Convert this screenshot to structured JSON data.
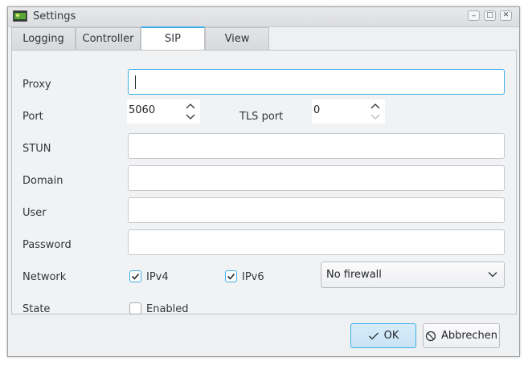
{
  "window": {
    "title": "Settings"
  },
  "titlebar_buttons": {
    "minimize": "_",
    "maximize": "□",
    "close": "✕"
  },
  "tabs": [
    {
      "label": "Logging",
      "active": false
    },
    {
      "label": "Controller",
      "active": false
    },
    {
      "label": "SIP",
      "active": true
    },
    {
      "label": "View",
      "active": false
    }
  ],
  "sip": {
    "proxy": {
      "label": "Proxy",
      "value": ""
    },
    "port": {
      "label": "Port",
      "value": "5060"
    },
    "tls_port": {
      "label": "TLS port",
      "value": "0"
    },
    "stun": {
      "label": "STUN",
      "value": ""
    },
    "domain": {
      "label": "Domain",
      "value": ""
    },
    "user": {
      "label": "User",
      "value": ""
    },
    "password": {
      "label": "Password",
      "value": ""
    },
    "network": {
      "label": "Network",
      "ipv4": {
        "label": "IPv4",
        "checked": true
      },
      "ipv6": {
        "label": "IPv6",
        "checked": true
      },
      "firewall": {
        "selected": "No firewall"
      }
    },
    "state": {
      "label": "State",
      "enabled": {
        "label": "Enabled",
        "checked": false
      }
    }
  },
  "buttons": {
    "ok": "OK",
    "cancel": "Abbrechen"
  },
  "colors": {
    "accent": "#3daee9",
    "window_bg": "#eff0f1",
    "text": "#31363b"
  }
}
